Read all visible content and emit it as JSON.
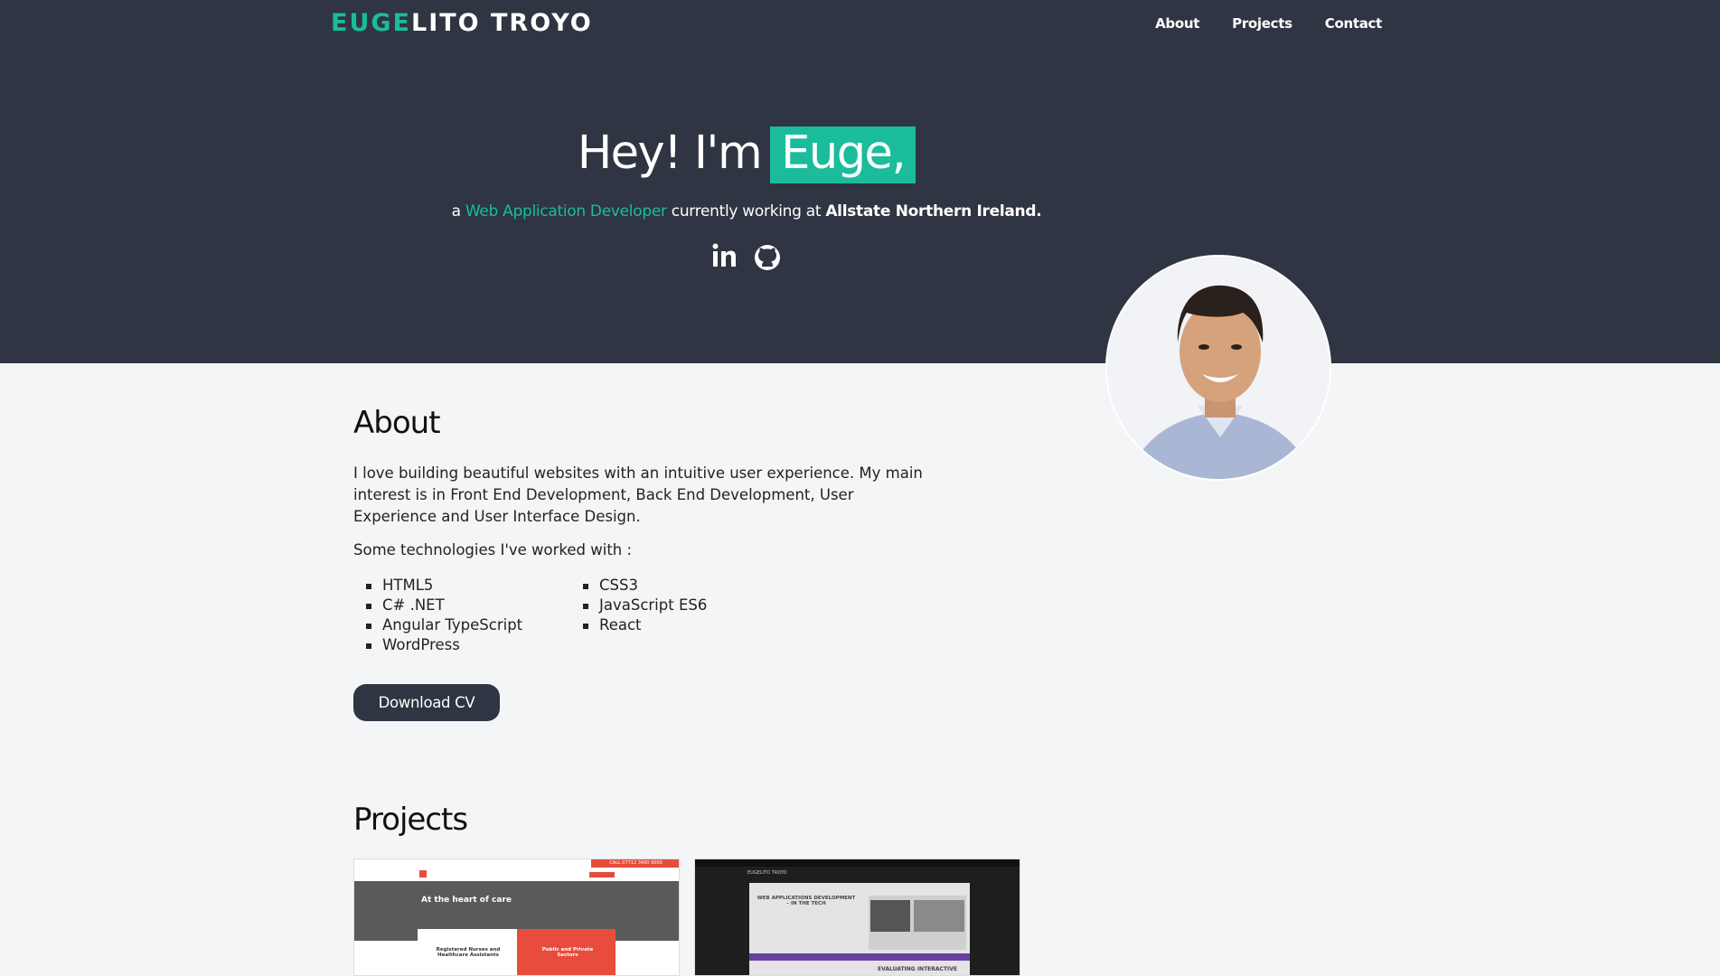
{
  "header": {
    "logo_accent": "EUGE",
    "logo_rest": "LITO TROYO",
    "nav": [
      "About",
      "Projects",
      "Contact"
    ]
  },
  "hero": {
    "greeting": "Hey! I'm",
    "name": "Euge,",
    "sub_prefix": "a",
    "role": "Web Application Developer",
    "sub_middle": "currently working at",
    "company": "Allstate Northern Ireland."
  },
  "socials": [
    "linkedin-icon",
    "github-icon"
  ],
  "about": {
    "title": "About",
    "paragraph": "I love building beautiful websites with an intuitive user experience. My main interest is in Front End Development, Back End Development, User Experience and User Interface Design.",
    "tech_intro": "Some technologies I've worked with :",
    "tech": [
      "HTML5",
      "C# .NET",
      "Angular TypeScript",
      "WordPress",
      "CSS3",
      "JavaScript ES6",
      "React"
    ],
    "cv_button": "Download CV"
  },
  "projects": {
    "title": "Projects",
    "cards": [
      {
        "top_bar": "CALL 07712 3400 9000",
        "headline": "At the heart of care",
        "box_left": "Registered Nurses and Healthcare Assistants",
        "box_right": "Public and Private Sectors"
      },
      {
        "logo": "EUGELITO TROYO",
        "headline": "WEB APPLICATIONS DEVELOPMENT – IN THE TECH",
        "sub": "EVALUATING INTERACTIVE"
      }
    ]
  },
  "colors": {
    "accent": "#1abc9c",
    "hero_bg": "#2f3542",
    "page_bg": "#f4f5f7"
  }
}
